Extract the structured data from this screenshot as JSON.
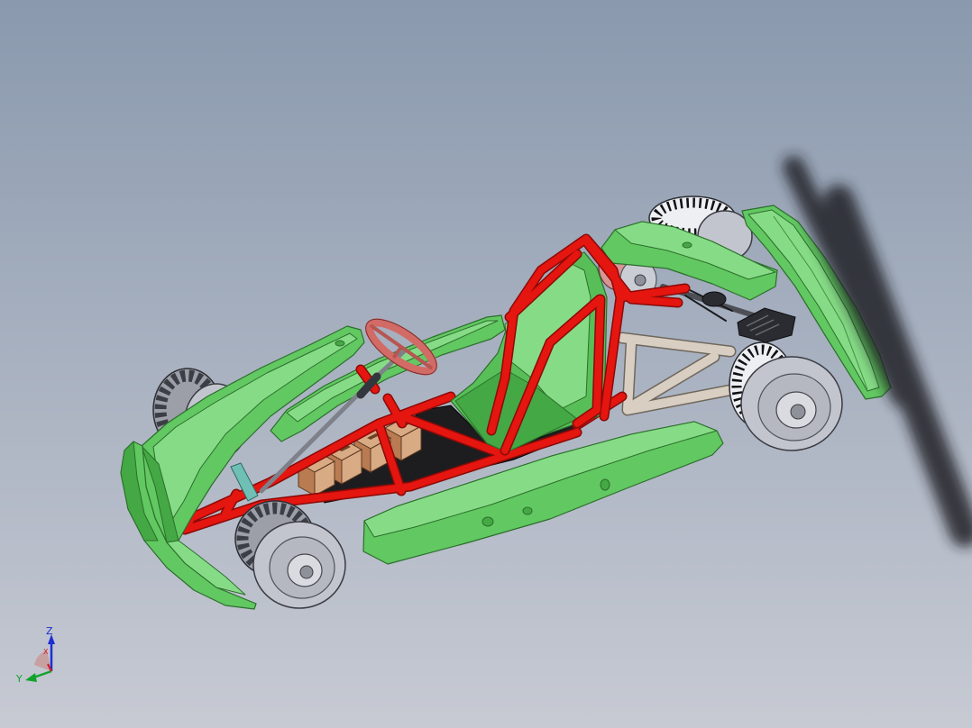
{
  "colors": {
    "background_top": "#8a99ae",
    "background_bottom": "#c7cad3",
    "body": "#62c862",
    "body_light": "#86dc86",
    "body_dark": "#44a844",
    "body_edge": "#2c6e2c",
    "seat": "#58bf58",
    "frame": "#e5150f",
    "frame_dark": "#8a0a08",
    "tire_gray": "#9c9ea8",
    "tire_white": "#eeeff2",
    "sidewall": "#c3c5ce",
    "hub": "#d9dbe1",
    "battery_top": "#d9ab85",
    "battery_side": "#b97b52",
    "floor": "#1d1d1f",
    "subframe": "#d8cec1",
    "steering_wheel": "#d26a66",
    "motor": "#2b2c31",
    "axis_z": "#1c2ed2",
    "axis_y": "#12a32a",
    "axis_x": "#d41c1c"
  },
  "triad": {
    "z_label": "Z",
    "y_label": "Y",
    "x_label": "X"
  }
}
